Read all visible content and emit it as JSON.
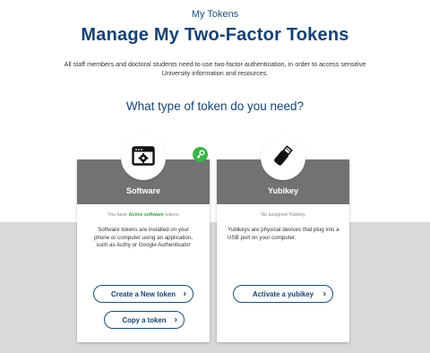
{
  "header": {
    "breadcrumb": "My Tokens",
    "title": "Manage My Two-Factor Tokens",
    "intro_line1": "All staff members and doctoral students need to use two-factor authentication, in order to access sensitive",
    "intro_line2": "University information and resources.",
    "question": "What type of token do you need?"
  },
  "cards": {
    "software": {
      "title": "Software",
      "status_prefix": "You have",
      "status_highlight": "Active software",
      "status_suffix": "tokens",
      "description": "Software tokens are installed on your phone or computer using an application, such as Authy or Google Authenticator",
      "create_label": "Create a New token",
      "copy_label": "Copy a token",
      "icon": "app-window-gear-icon",
      "badge_icon": "key-icon"
    },
    "yubikey": {
      "title": "Yubikey",
      "status": "No assigned Yubikey",
      "description": "Yubikeys are physical devices that plug into a USB port on your computer.",
      "activate_label": "Activate a yubikey",
      "icon": "usb-key-icon"
    }
  },
  "colors": {
    "primary": "#154273",
    "card_header": "#717272",
    "active_green": "#3aa64b",
    "band_grey": "#d9d9d9"
  }
}
